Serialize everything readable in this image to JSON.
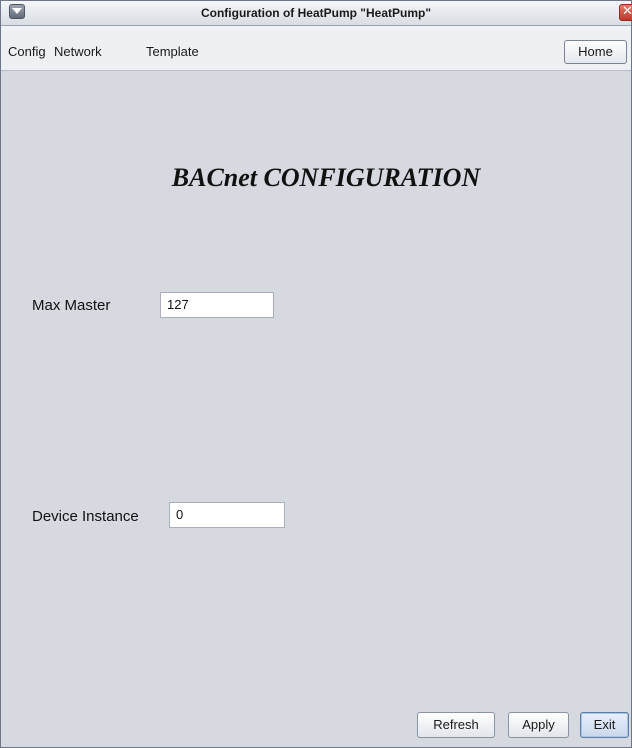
{
  "window": {
    "title": "Configuration of HeatPump \"HeatPump\""
  },
  "menubar": {
    "items": [
      "Config",
      "Network",
      "Template"
    ],
    "home_label": "Home"
  },
  "main": {
    "heading": "BACnet CONFIGURATION",
    "fields": [
      {
        "label": "Max Master",
        "value": "127"
      },
      {
        "label": "Device Instance",
        "value": "0"
      }
    ]
  },
  "footer": {
    "refresh_label": "Refresh",
    "apply_label": "Apply",
    "exit_label": "Exit"
  },
  "icons": {
    "window_menu": "chevron-down-icon",
    "close": "close-icon"
  },
  "colors": {
    "background": "#d6d9df",
    "close_button": "#c0392b"
  }
}
